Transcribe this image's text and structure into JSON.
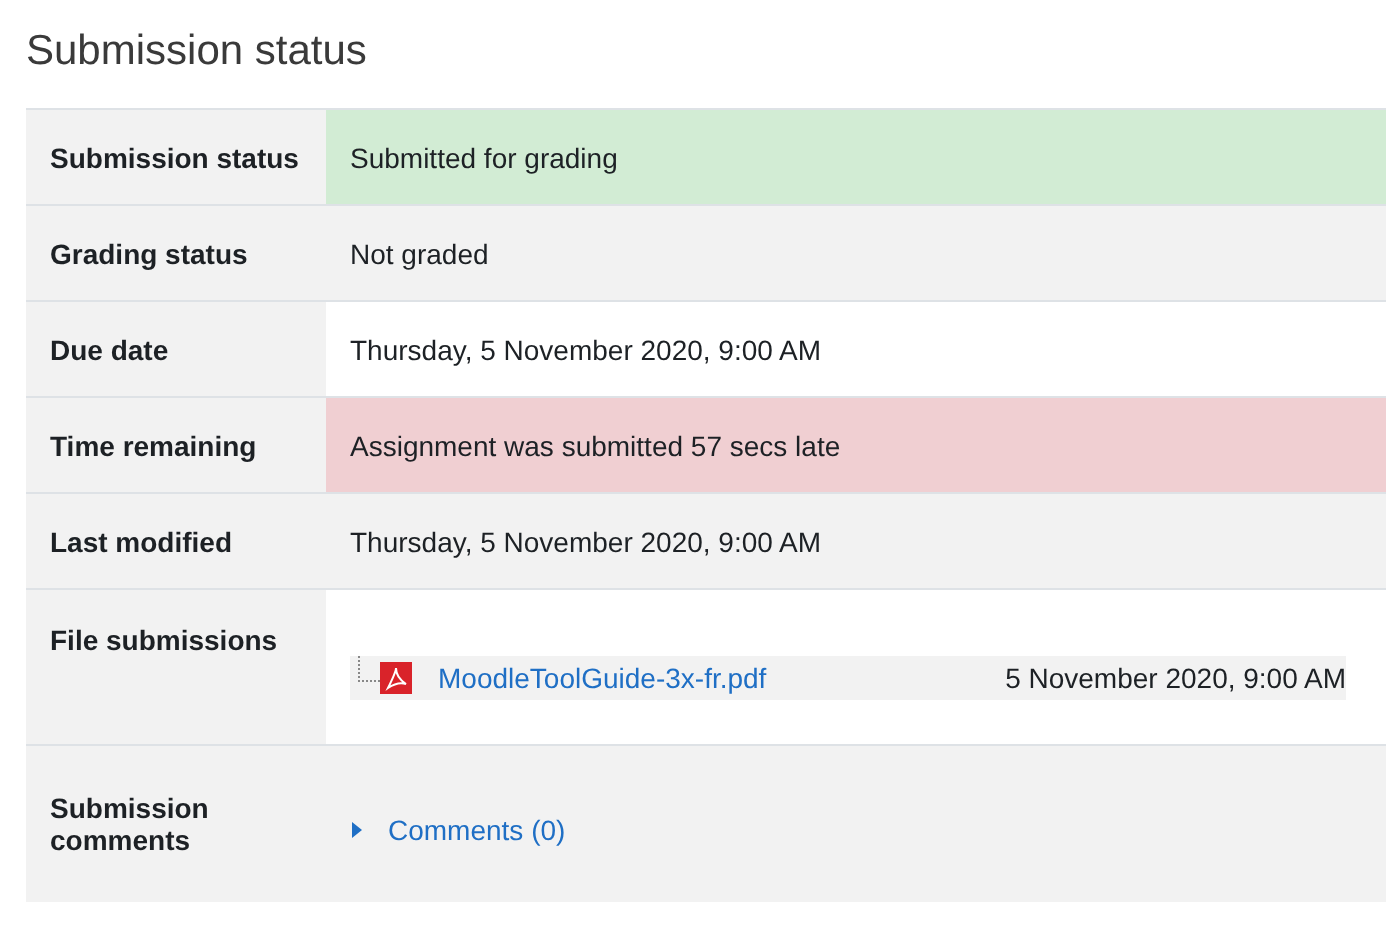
{
  "heading": "Submission status",
  "rows": [
    {
      "kind": "text",
      "label": "Submission status",
      "value": "Submitted for grading",
      "color": "#d2ecd4"
    },
    {
      "kind": "text",
      "label": "Grading status",
      "value": "Not graded"
    },
    {
      "kind": "text",
      "label": "Due date",
      "value": "Thursday, 5 November 2020, 9:00 AM"
    },
    {
      "kind": "text",
      "label": "Time remaining",
      "value": "Assignment was submitted 57 secs late",
      "color": "#f0cfd2"
    },
    {
      "kind": "text",
      "label": "Last modified",
      "value": "Thursday, 5 November 2020, 9:00 AM"
    },
    {
      "kind": "file",
      "label": "File submissions",
      "file": {
        "name": "MoodleToolGuide-3x-fr.pdf",
        "date": "5 November 2020, 9:00 AM"
      }
    },
    {
      "kind": "comments",
      "label": "Submission comments",
      "link": "Comments (0)",
      "expanded": false
    }
  ]
}
